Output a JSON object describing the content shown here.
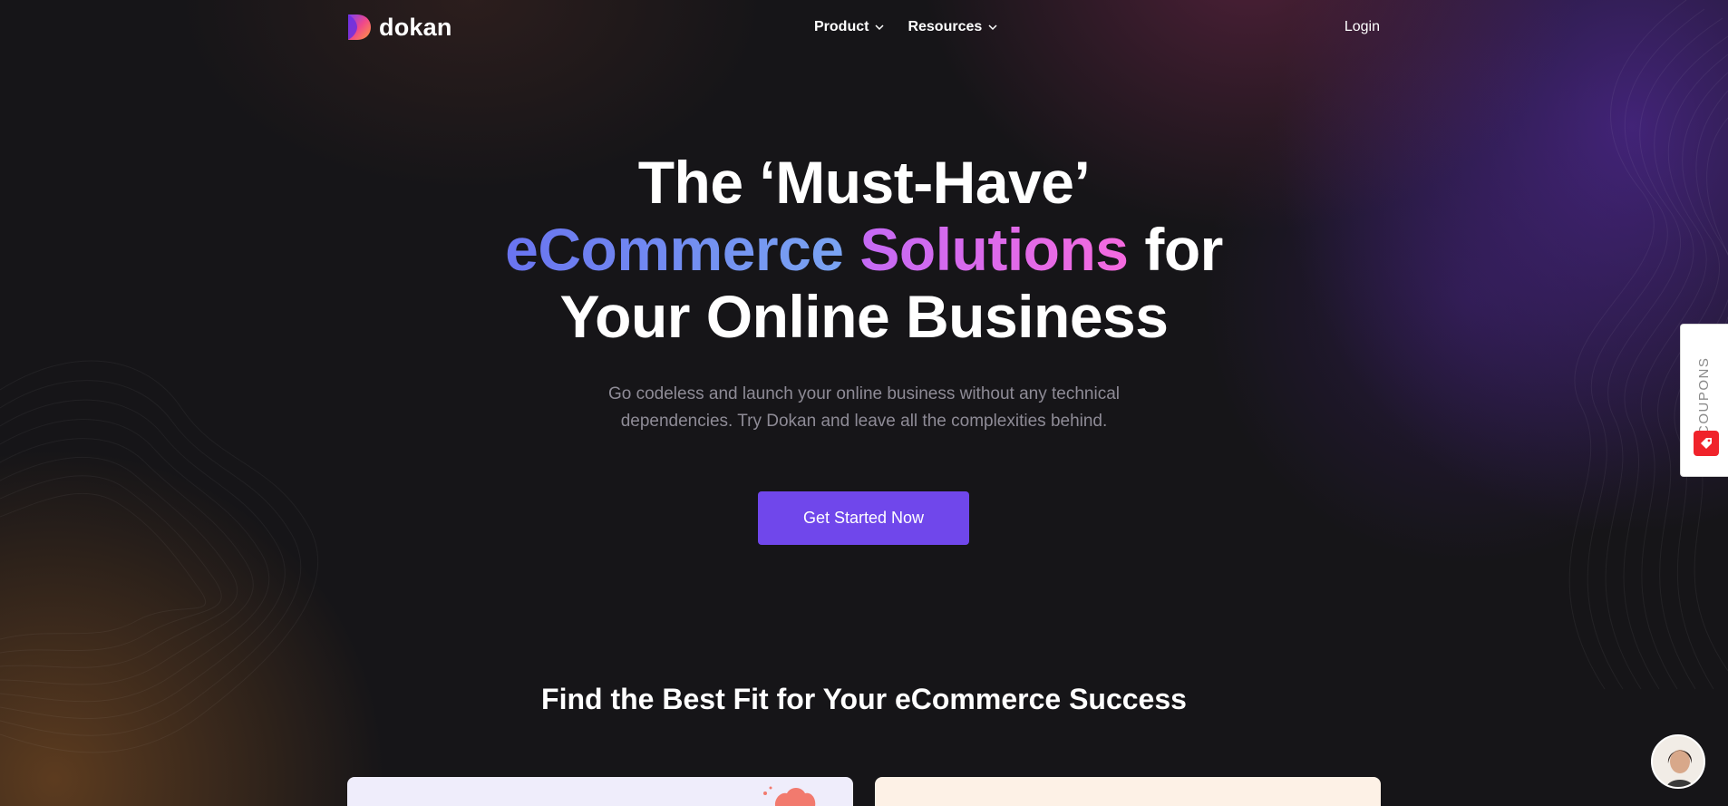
{
  "brand": {
    "name": "dokan",
    "logo_icon": "dokan-logo-icon"
  },
  "nav": {
    "items": [
      {
        "label": "Product",
        "icon": "chevron-down-icon"
      },
      {
        "label": "Resources",
        "icon": "chevron-down-icon"
      }
    ],
    "login_label": "Login"
  },
  "hero": {
    "title_line1": "The ‘Must-Have’",
    "title_word_blue": "eCommerce",
    "title_word_pink": "Solutions",
    "title_word_for": "for",
    "title_line3": "Your Online Business",
    "subtitle": "Go codeless and launch your online business without any technical dependencies. Try Dokan and leave all the complexities behind.",
    "cta_label": "Get Started Now"
  },
  "section": {
    "title": "Find the Best Fit for Your eCommerce Success"
  },
  "coupons_tab": {
    "label": "COUPONS",
    "icon": "coupon-tag-icon"
  },
  "chat": {
    "avatar": "support-agent-avatar"
  },
  "colors": {
    "background": "#161518",
    "cta": "#7047eb",
    "accent_blue": "#6a74f0",
    "accent_pink": "#f56adf",
    "coupon_red": "#f0232b"
  }
}
